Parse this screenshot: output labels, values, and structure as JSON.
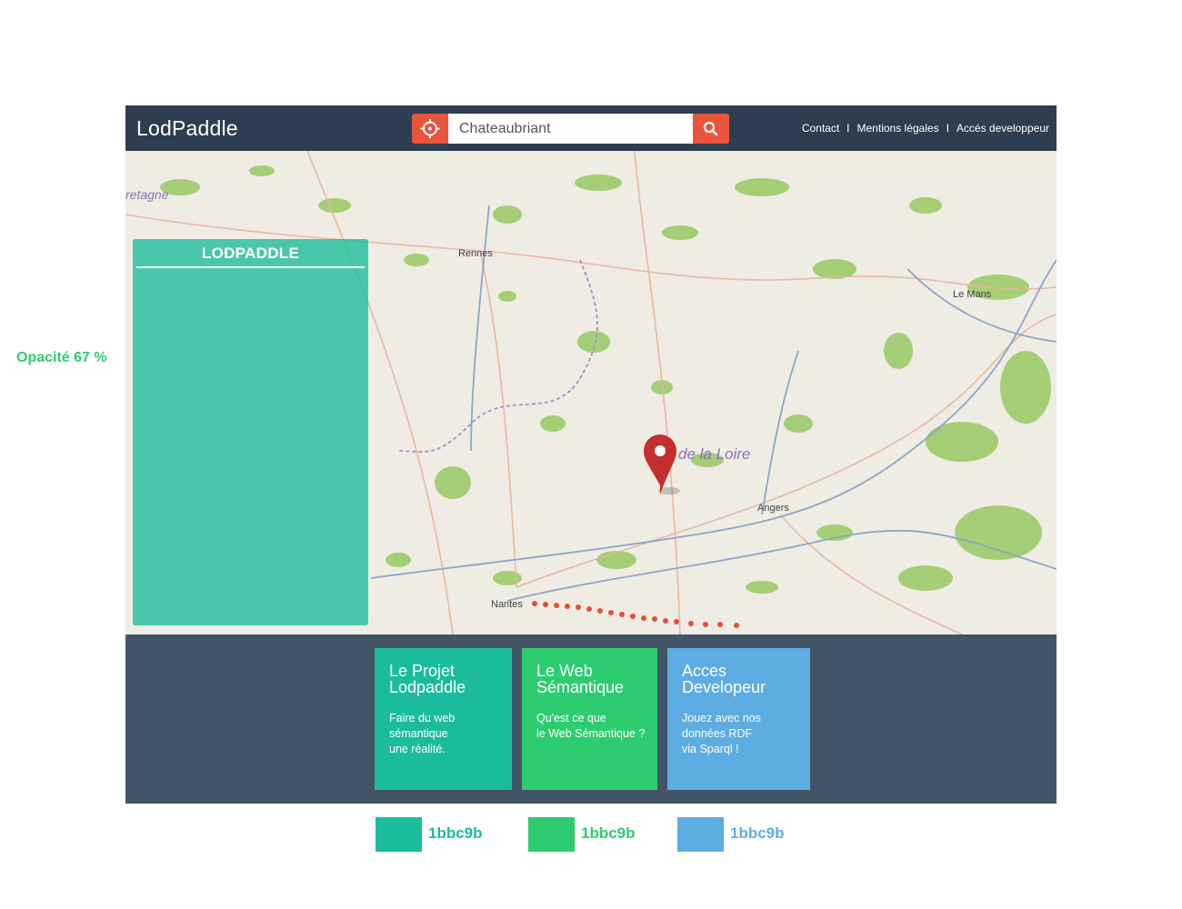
{
  "annotation": {
    "text": "Opacité 67 %",
    "color": "#2ecc71"
  },
  "header": {
    "logo": "LodPaddle",
    "search_value": "Chateaubriant",
    "nav": [
      "Contact",
      "Mentions légales",
      "Accés developpeur"
    ],
    "separator": "I"
  },
  "icons": {
    "locate": "crosshair-icon",
    "search": "search-icon",
    "marker": "map-marker-icon"
  },
  "map_labels": {
    "bretagne": "retagne",
    "rennes": "Rennes",
    "le_mans": "Le Mans",
    "region": "de la Loire",
    "angers": "Angers",
    "nantes": "Nantes"
  },
  "side_panel": {
    "title": "LODPADDLE",
    "opacity_percent": 67
  },
  "cards": [
    {
      "title": "Le Projet\nLodpaddle",
      "desc": "Faire du web\nsémantique\nune réalité.",
      "color": "#1bbc9b"
    },
    {
      "title": "Le Web\nSémantique",
      "desc": "Qu'est ce que\nle Web Sémantique ?",
      "color": "#2ecc71"
    },
    {
      "title": "Acces\nDevelopeur",
      "desc": "Jouez avec nos\ndonnées RDF\nvia Sparql !",
      "color": "#5dade2"
    }
  ],
  "swatches": [
    {
      "label": "1bbc9b",
      "color": "#1bbc9b"
    },
    {
      "label": "1bbc9b",
      "color": "#2ecc71"
    },
    {
      "label": "1bbc9b",
      "color": "#5dade2"
    }
  ],
  "colors": {
    "header_bg": "#2e3d4f",
    "accent_orange": "#e8553a",
    "bottom_bg": "#435466",
    "marker_red": "#c62f2f",
    "route_dots": "#e74c3c"
  }
}
